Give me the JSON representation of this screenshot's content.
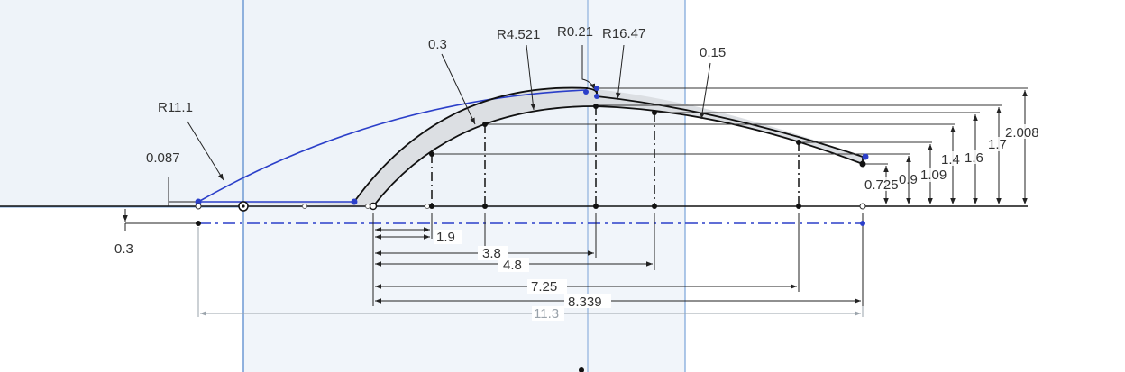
{
  "sketch": {
    "colors": {
      "background": "#ffffff",
      "plane_fill": "#eef3f9",
      "plane_edge": "#7aa3d8",
      "profile_fill": "#dcdfe3",
      "profile_line": "#111111",
      "construction": "#2b3fc9",
      "dimension_line": "#222222",
      "driven_dimension": "#9aa3ab"
    },
    "dimensions": {
      "r11_1": "R11.1",
      "d0_087": "0.087",
      "d0_3_left": "0.3",
      "d0_3_top": "0.3",
      "r4_521": "R4.521",
      "r0_21": "R0.21",
      "r16_47": "R16.47",
      "d0_15": "0.15",
      "h2_008": "2.008",
      "h1_7": "1.7",
      "h1_6": "1.6",
      "h1_4": "1.4",
      "h1_09": "1.09",
      "h0_9": "0.9",
      "h0_725": "0.725",
      "x1_9": "1.9",
      "x3_8": "3.8",
      "x4_8": "4.8",
      "x7_25": "7.25",
      "x8_339": "8.339",
      "x11_3": "11.3"
    }
  }
}
